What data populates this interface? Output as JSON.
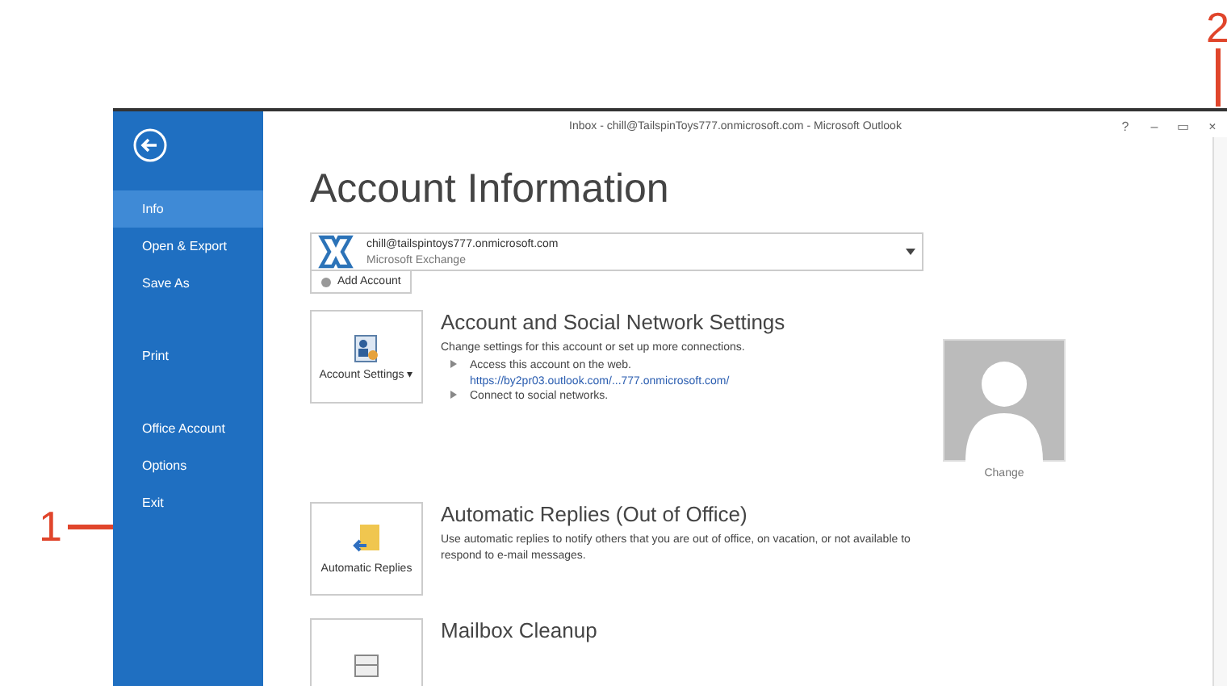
{
  "callouts": [
    {
      "label": "1",
      "kind": "left"
    },
    {
      "label": "2",
      "kind": "top"
    }
  ],
  "window": {
    "title": "Inbox - chill@TailspinToys777.onmicrosoft.com - Microsoft Outlook",
    "controls": [
      "?",
      "–",
      "▭",
      "×"
    ]
  },
  "sidebar": {
    "groups": [
      {
        "items": [
          {
            "label": "Info",
            "selected": true
          },
          {
            "label": "Open & Export",
            "selected": false
          },
          {
            "label": "Save As",
            "selected": false
          }
        ]
      },
      {
        "items": [
          {
            "label": "Print",
            "selected": false
          }
        ]
      },
      {
        "items": [
          {
            "label": "Office Account",
            "selected": false
          },
          {
            "label": "Options",
            "selected": false
          },
          {
            "label": "Exit",
            "selected": false
          }
        ]
      }
    ]
  },
  "page_title": "Account Information",
  "account": {
    "email": "chill@tailspintoys777.onmicrosoft.com",
    "type": "Microsoft Exchange",
    "add_button": "Add Account"
  },
  "sections": [
    {
      "button": "Account Settings ▾",
      "kind": "settings",
      "heading": "Account and Social Network Settings",
      "description": "Change settings for this account or set up more connections.",
      "bullets": [
        {
          "text": "Access this account on the web.",
          "link": "https://by2pr03.outlook.com/...777.onmicrosoft.com/"
        },
        {
          "text": "Connect to social networks."
        }
      ],
      "photo_label": "Change"
    },
    {
      "button": "Automatic Replies",
      "kind": "replies",
      "heading": "Automatic Replies (Out of Office)",
      "description": "Use automatic replies to notify others that you are out of office, on vacation, or not available to respond to e-mail messages."
    },
    {
      "kind": "cleanup",
      "heading": "Mailbox Cleanup"
    }
  ]
}
